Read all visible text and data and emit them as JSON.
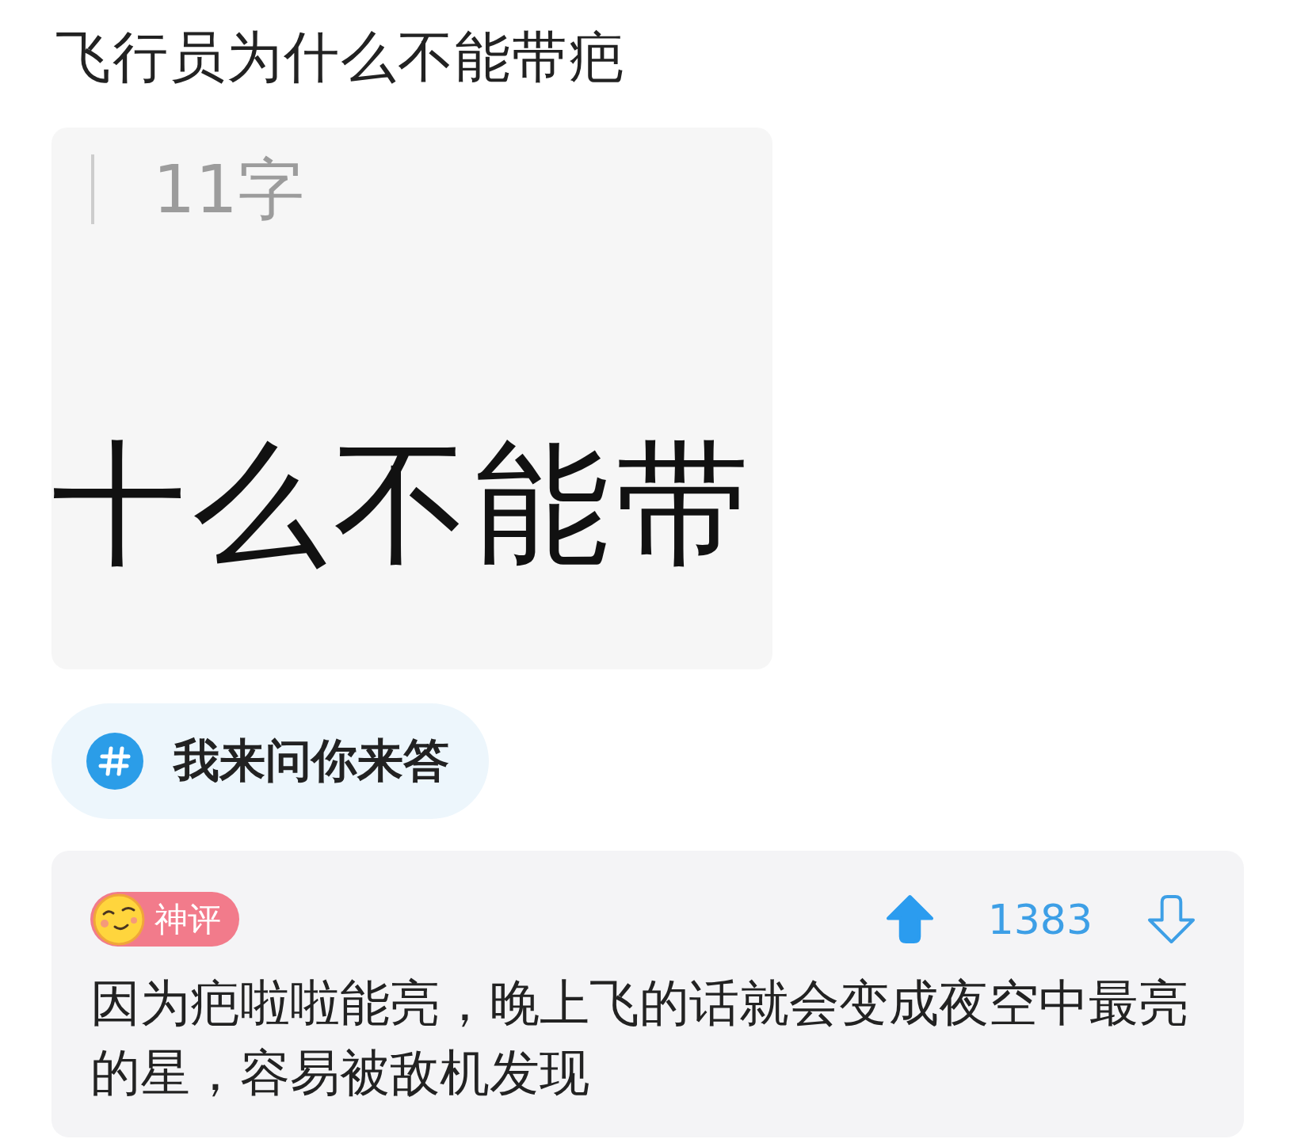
{
  "post": {
    "title": "飞行员为什么不能带疤"
  },
  "image": {
    "count_label": "11字",
    "big_text": "十么不能带"
  },
  "topic": {
    "label": "我来问你来答"
  },
  "comment": {
    "badge": "神评",
    "votes": {
      "count": "1383",
      "upvoted": true,
      "downvoted": false
    },
    "text": "因为疤啦啦能亮，晚上飞的话就会变成夜空中最亮的星，容易被敌机发现"
  }
}
